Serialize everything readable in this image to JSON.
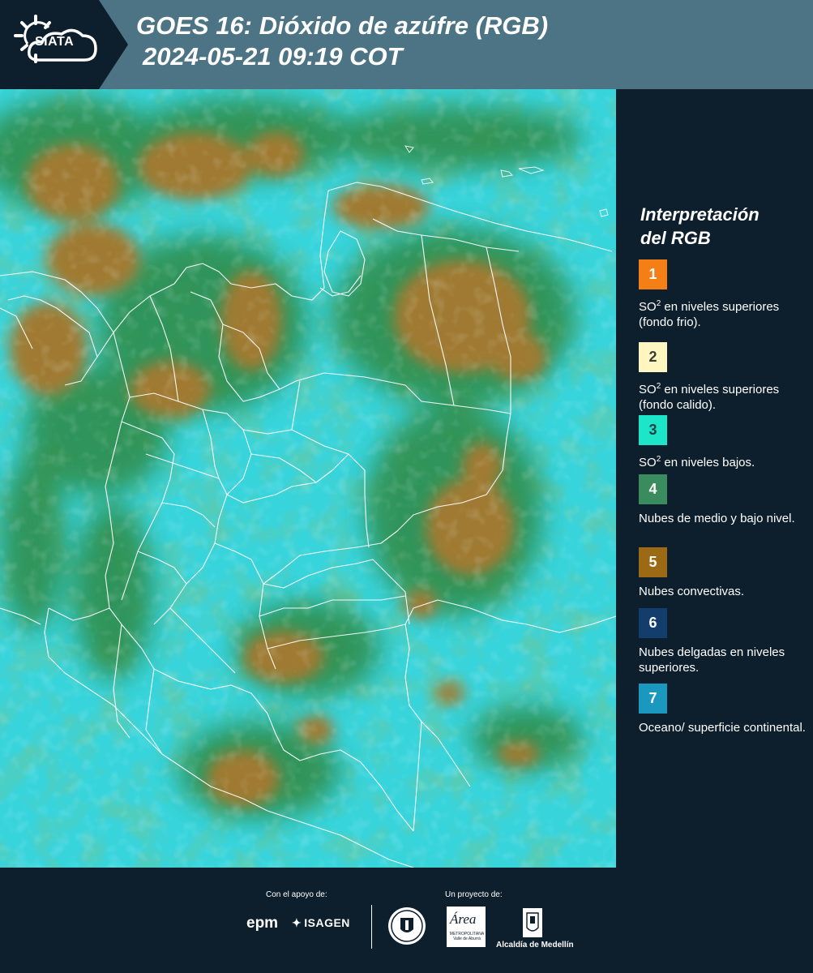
{
  "header": {
    "logo_text": "SIATA",
    "title": "GOES 16: Dióxido de azúfre (RGB)",
    "timestamp": "2024-05-21 09:19 COT"
  },
  "legend": {
    "title_line1": "Interpretación",
    "title_line2": "del RGB",
    "items": [
      {
        "number": "1",
        "color": "#f57f17",
        "text_color": "#ffffff",
        "desc_pre": "SO",
        "desc_sup": "2",
        "desc_post": " en niveles superiores (fondo frio)."
      },
      {
        "number": "2",
        "color": "#fdf6c0",
        "text_color": "#3a3a3a",
        "desc_pre": "SO",
        "desc_sup": "2",
        "desc_post": " en niveles superiores (fondo calido)."
      },
      {
        "number": "3",
        "color": "#1de6c8",
        "text_color": "#1e3e46",
        "desc_pre": "SO",
        "desc_sup": "2",
        "desc_post": " en niveles bajos."
      },
      {
        "number": "4",
        "color": "#3a8c5e",
        "text_color": "#ffffff",
        "desc_pre": "",
        "desc_sup": "",
        "desc_post": "Nubes de medio y bajo nivel."
      },
      {
        "number": "5",
        "color": "#9c6a14",
        "text_color": "#ffffff",
        "desc_pre": "",
        "desc_sup": "",
        "desc_post": "Nubes convectivas."
      },
      {
        "number": "6",
        "color": "#123d6c",
        "text_color": "#ffffff",
        "desc_pre": "",
        "desc_sup": "",
        "desc_post": "Nubes delgadas en niveles superiores."
      },
      {
        "number": "7",
        "color": "#1b98c0",
        "text_color": "#ffffff",
        "desc_pre": "",
        "desc_sup": "",
        "desc_post": "Oceano/ superficie continental."
      }
    ]
  },
  "footer": {
    "support_label": "Con el apoyo de:",
    "project_label": "Un proyecto de:",
    "epm": "epm",
    "isagen": "ISAGEN",
    "metro_word": "Área",
    "metro_sub": "METROPOLITANA Valle de Aburrá",
    "alcaldia": "Alcaldía de Medellín"
  },
  "colors": {
    "header_bg": "#4d7484",
    "panel_bg": "#0d1e2c",
    "map_base": "#38d4dc",
    "cloud_green": "#2f8a44",
    "cloud_brown": "#9a7a2c",
    "border_white": "#ffffff"
  }
}
